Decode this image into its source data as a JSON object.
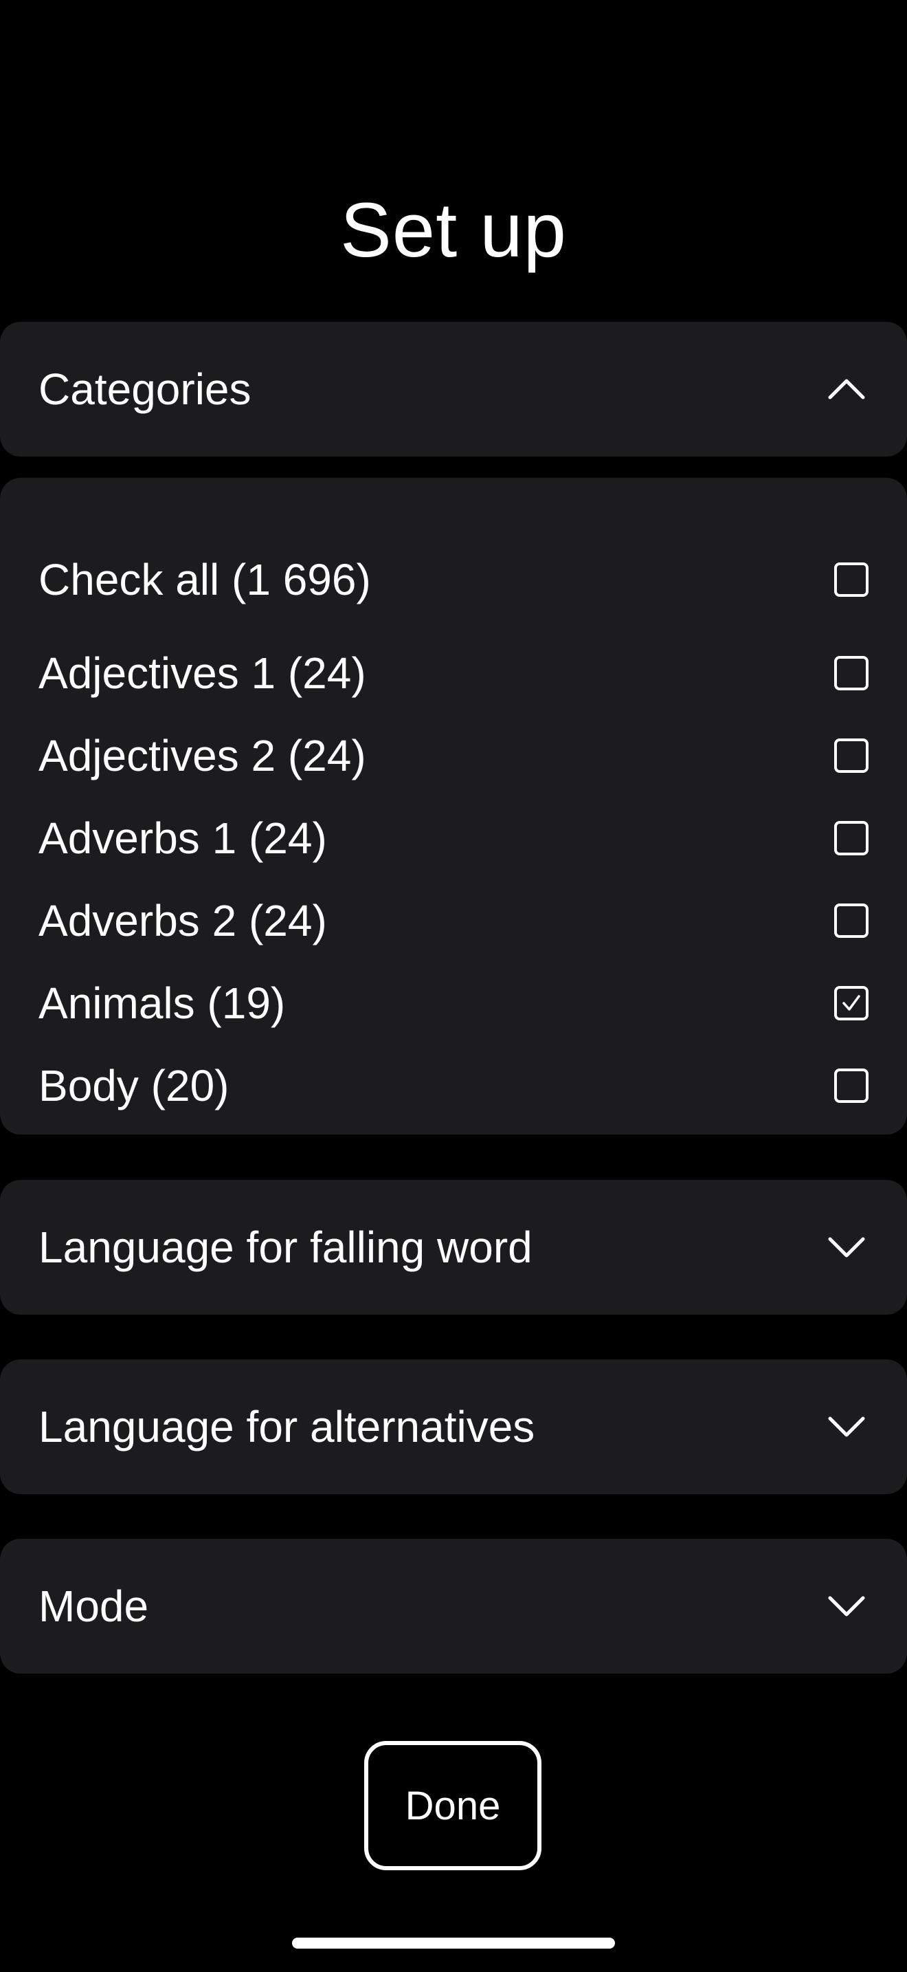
{
  "page": {
    "title": "Set up"
  },
  "categories": {
    "header_label": "Categories",
    "expanded": true,
    "check_all": {
      "label": "Check all (1 696)",
      "checked": false
    },
    "items": [
      {
        "label": "Adjectives 1 (24)",
        "checked": false
      },
      {
        "label": "Adjectives 2 (24)",
        "checked": false
      },
      {
        "label": "Adverbs 1 (24)",
        "checked": false
      },
      {
        "label": "Adverbs 2 (24)",
        "checked": false
      },
      {
        "label": "Animals (19)",
        "checked": true
      },
      {
        "label": "Body (20)",
        "checked": false
      }
    ]
  },
  "sections": {
    "falling_word_label": "Language for falling word",
    "alternatives_label": "Language for alternatives",
    "mode_label": "Mode"
  },
  "actions": {
    "done_label": "Done"
  },
  "icons": {
    "expanded": "chevron-up-icon",
    "collapsed": "chevron-down-icon",
    "checked": "checkmark-icon"
  },
  "colors": {
    "background": "#000000",
    "panel": "#1c1c1e",
    "text": "#ffffff"
  }
}
